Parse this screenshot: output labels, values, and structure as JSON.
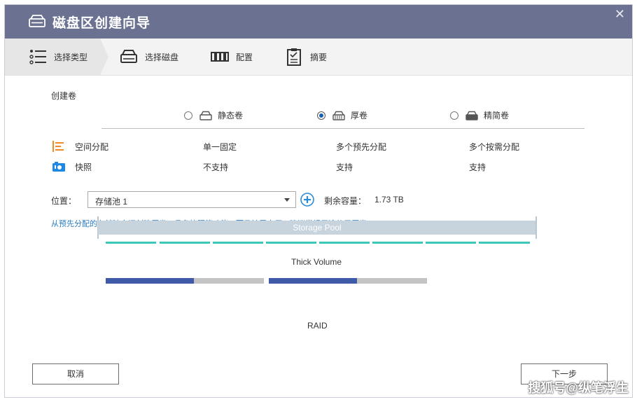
{
  "window": {
    "title": "磁盘区创建向导",
    "close_glyph": "✕"
  },
  "steps": [
    {
      "label": "选择类型",
      "icon": "list-icon",
      "active": true
    },
    {
      "label": "选择磁盘",
      "icon": "disk-icon",
      "active": false
    },
    {
      "label": "配置",
      "icon": "config-icon",
      "active": false
    },
    {
      "label": "摘要",
      "icon": "clipboard-icon",
      "active": false
    }
  ],
  "create_volume": {
    "heading": "创建卷",
    "options": [
      {
        "label": "静态卷",
        "checked": false
      },
      {
        "label": "厚卷",
        "checked": true
      },
      {
        "label": "精简卷",
        "checked": false
      }
    ]
  },
  "features": [
    {
      "name": "空间分配",
      "icon": "allocation-icon",
      "values": [
        "单一固定",
        "多个预先分配",
        "多个按需分配"
      ]
    },
    {
      "name": "快照",
      "icon": "camera-icon",
      "values": [
        "不支持",
        "支持",
        "支持"
      ]
    }
  ],
  "location": {
    "label": "位置：",
    "selected": "存储池 1",
    "free_label": "剩余容量：",
    "free_value": "1.73 TB"
  },
  "description": "从预先分配的存储池空间创建厚卷，具备快照等功能，而且扩展方便，建议常规用途使用厚卷。",
  "diagram": {
    "volume_label": "Thick Volume",
    "pool_label": "Storage Pool",
    "raid_label": "RAID",
    "volumes_used_fraction": [
      0.5,
      0.5
    ],
    "colors": {
      "used": "#3f5aa8",
      "free": "#c3c3c3",
      "pool": "#c7d3dd",
      "raid": "#3bc8b8"
    }
  },
  "buttons": {
    "cancel": "取消",
    "next": "下一步"
  },
  "watermark": "搜狐号@纵笔浮生",
  "colors": {
    "titlebar": "#6b7291",
    "accent": "#2a7bbf",
    "radio": "#1a5fb4"
  }
}
